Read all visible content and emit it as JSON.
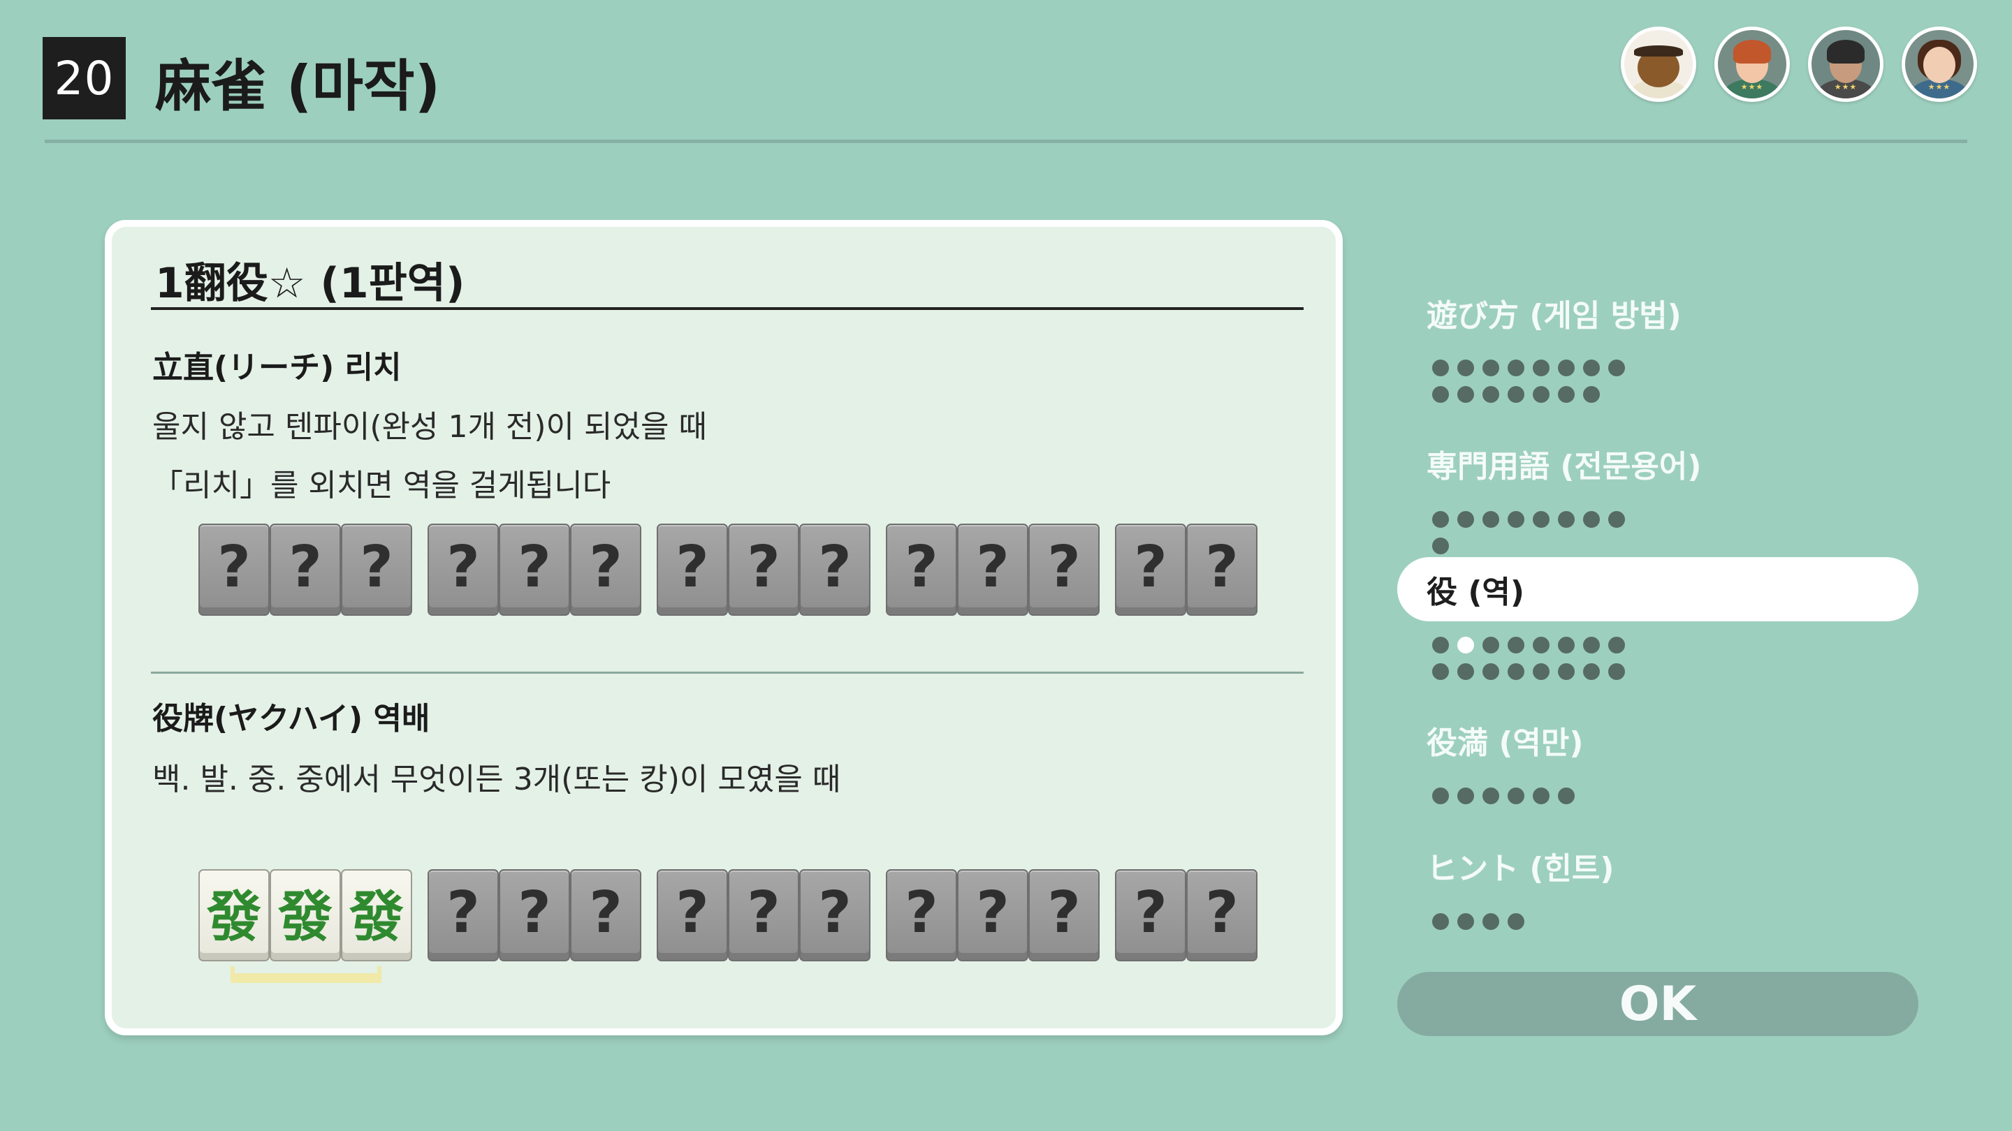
{
  "header": {
    "game_number": "20",
    "title": "麻雀 (마작)",
    "players": [
      {
        "icon": "raccoon-avatar",
        "stars": ""
      },
      {
        "icon": "player-avatar",
        "stars": "★★★"
      },
      {
        "icon": "player-avatar",
        "stars": "★★★"
      },
      {
        "icon": "player-avatar",
        "stars": "★★★"
      }
    ]
  },
  "card": {
    "title": "1翻役☆ (1판역)",
    "section1": {
      "heading": "立直(リーチ) 리치",
      "lines": [
        "울지 않고 텐파이(완성 1개 전)이 되었을 때",
        "「리치」를 외치면 역을 걸게됩니다"
      ],
      "tile_groups": [
        [
          "?",
          "?",
          "?"
        ],
        [
          "?",
          "?",
          "?"
        ],
        [
          "?",
          "?",
          "?"
        ],
        [
          "?",
          "?",
          "?"
        ],
        [
          "?",
          "?"
        ]
      ]
    },
    "section2": {
      "heading": "役牌(ヤクハイ) 역배",
      "lines": [
        "백. 발. 중. 중에서 무엇이든 3개(또는 캉)이 모였을 때"
      ],
      "tile_groups": [
        [
          "發",
          "發",
          "發"
        ],
        [
          "?",
          "?",
          "?"
        ],
        [
          "?",
          "?",
          "?"
        ],
        [
          "?",
          "?",
          "?"
        ],
        [
          "?",
          "?"
        ]
      ]
    }
  },
  "menu": {
    "items": [
      {
        "label": "遊び方 (게임 방법)",
        "dot_count": 15,
        "current_dot": -1,
        "selected": false
      },
      {
        "label": "専門用語 (전문용어)",
        "dot_count": 9,
        "current_dot": -1,
        "selected": false
      },
      {
        "label": "役 (역)",
        "dot_count": 16,
        "current_dot": 1,
        "selected": true
      },
      {
        "label": "役満 (역만)",
        "dot_count": 6,
        "current_dot": -1,
        "selected": false
      },
      {
        "label": "ヒント (힌트)",
        "dot_count": 4,
        "current_dot": -1,
        "selected": false
      }
    ],
    "ok_label": "OK"
  },
  "colors": {
    "background": "#9dcfbe",
    "card": "#e4f1e7",
    "menu_text": "#f4fbf8",
    "dot": "#566b63",
    "ok_button": "#85aba0",
    "highlight_bar": "#f0e9a8"
  }
}
